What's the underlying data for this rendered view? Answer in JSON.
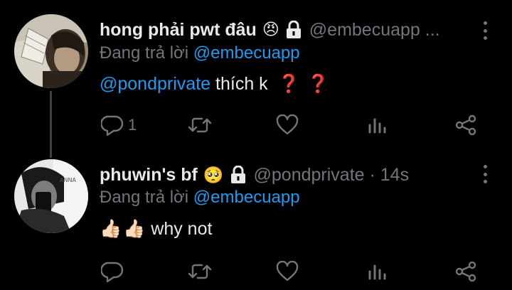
{
  "colors": {
    "accent": "#1d9bf0",
    "muted": "#71767b",
    "text": "#e7e9ea",
    "background": "#000000"
  },
  "tweets": [
    {
      "display_name": "hong phải pwt đâu",
      "name_emoji": "😠",
      "locked": true,
      "handle": "@embecuapp ...",
      "replying_prefix": "Đang trả lời",
      "replying_to": "@embecuapp",
      "body_mention": "@pondprivate",
      "body_text": "thích k",
      "body_emoji": [
        "❓",
        "❓"
      ],
      "reply_count": "1",
      "icons": [
        "reply-icon",
        "retweet-icon",
        "like-icon",
        "analytics-icon",
        "share-icon"
      ]
    },
    {
      "display_name": "phuwin's bf",
      "name_emoji": "🥺",
      "locked": true,
      "handle": "@pondprivate · 14s",
      "replying_prefix": "Đang trả lời",
      "replying_to": "@embecuapp",
      "body_emoji": [
        "👍🏻",
        "👍🏻"
      ],
      "body_text": "why not",
      "reply_count": "",
      "icons": [
        "reply-icon",
        "retweet-icon",
        "like-icon",
        "analytics-icon",
        "share-icon"
      ]
    }
  ]
}
